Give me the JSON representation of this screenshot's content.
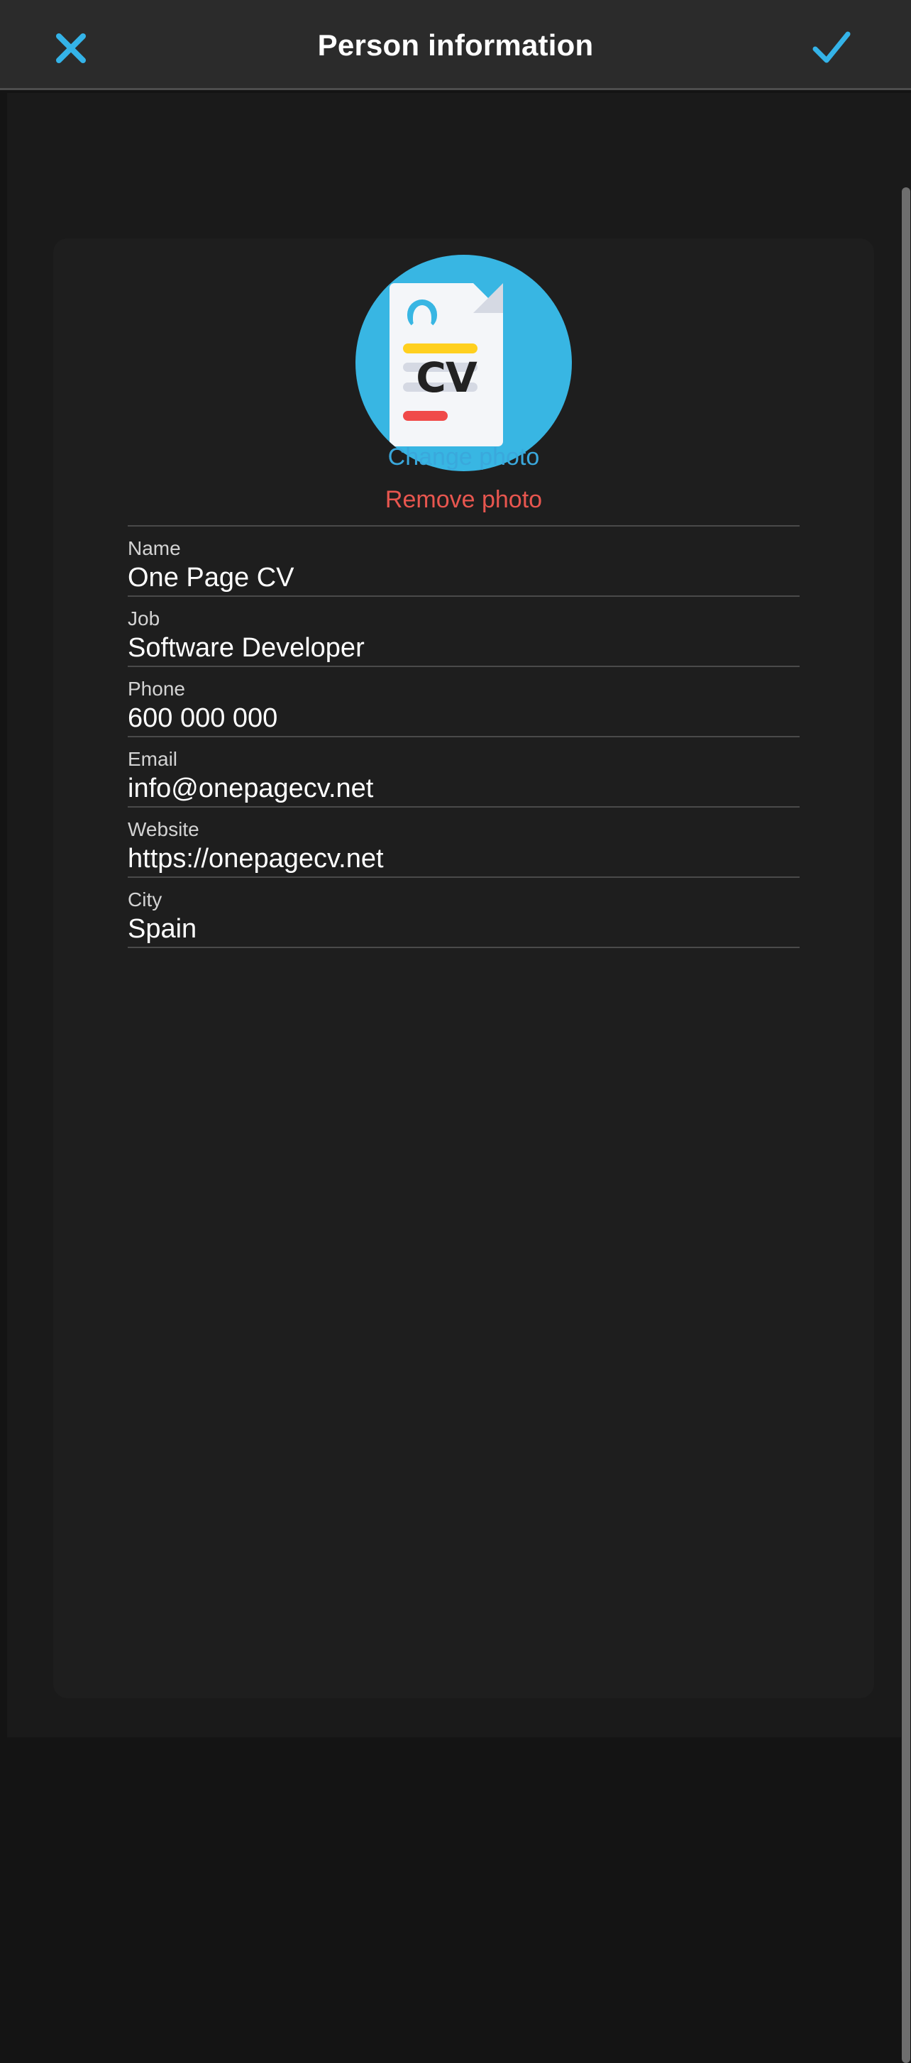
{
  "header": {
    "title": "Person information",
    "close_icon": "close-icon",
    "accept_icon": "check-icon",
    "accent_color": "#34b3e8"
  },
  "avatar": {
    "icon_name": "cv-document-icon",
    "cv_label": "CV",
    "circle_color": "#38b6e3",
    "sheet_color": "#f4f6f9",
    "bar_yellow_color": "#ffd01f",
    "bar_gray_color": "#d5d9e3",
    "bar_red_color": "#f04a49"
  },
  "photo_actions": {
    "change_label": "Change photo",
    "change_color": "#3aa8dc",
    "remove_label": "Remove photo",
    "remove_color": "#e8564f"
  },
  "form": {
    "fields": [
      {
        "label": "Name",
        "value": "One Page CV"
      },
      {
        "label": "Job",
        "value": "Software Developer"
      },
      {
        "label": "Phone",
        "value": "600 000 000"
      },
      {
        "label": "Email",
        "value": "info@onepagecv.net"
      },
      {
        "label": "Website",
        "value": "https://onepagecv.net"
      },
      {
        "label": "City",
        "value": "Spain"
      }
    ]
  }
}
